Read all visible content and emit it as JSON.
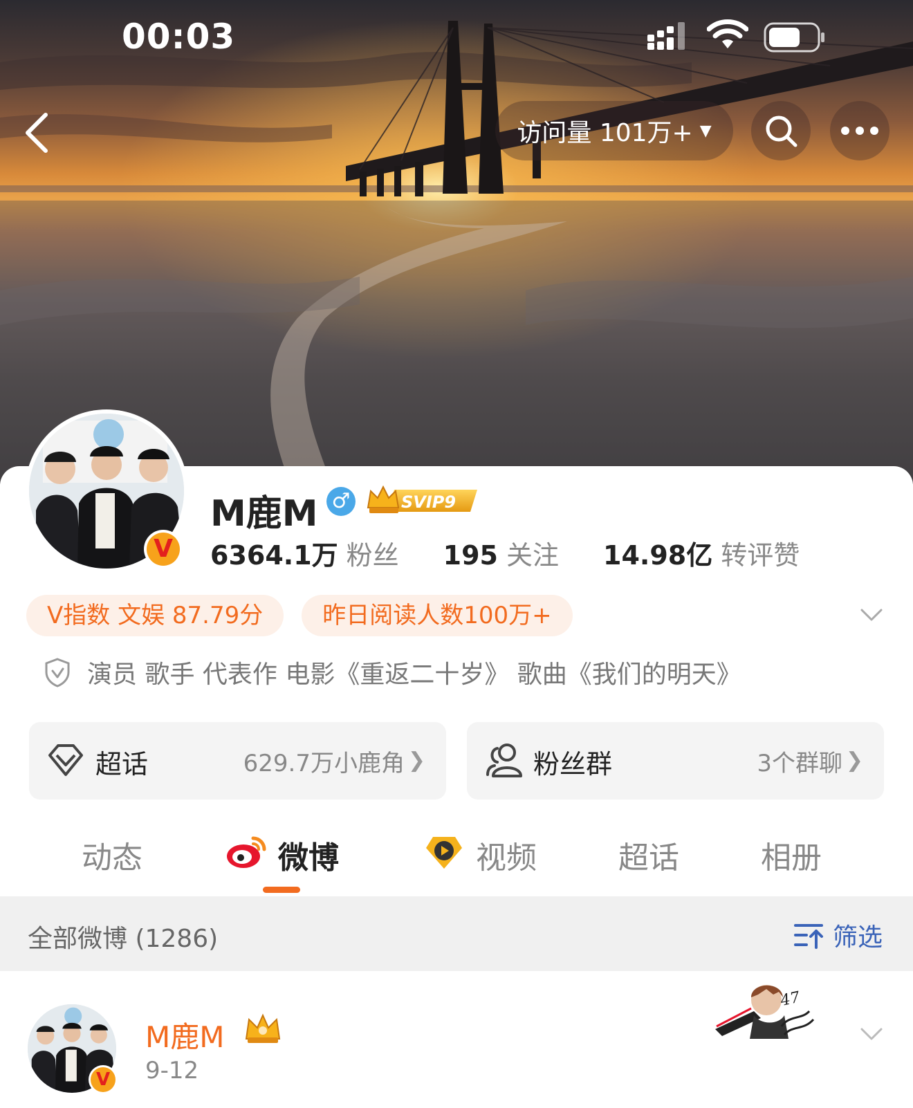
{
  "status_bar": {
    "time": "00:03"
  },
  "nav": {
    "visits_label": "访问量 101万+",
    "visits_caret": "▼"
  },
  "profile": {
    "name": "M鹿M",
    "gender_symbol": "♂",
    "svip_label": "SVIP9",
    "verified_mark": "V",
    "stats": [
      {
        "value": "6364.1万",
        "label": "粉丝"
      },
      {
        "value": "195",
        "label": "关注"
      },
      {
        "value": "14.98亿",
        "label": "转评赞"
      }
    ],
    "tags": [
      "V指数 文娱 87.79分",
      "昨日阅读人数100万+"
    ],
    "verification": "演员 歌手 代表作 电影《重返二十岁》 歌曲《我们的明天》"
  },
  "boxes": [
    {
      "title": "超话",
      "value": "629.7万小鹿角",
      "icon": "diamond-icon"
    },
    {
      "title": "粉丝群",
      "value": "3个群聊",
      "icon": "group-icon"
    }
  ],
  "tabs": [
    "动态",
    "微博",
    "视频",
    "超话",
    "相册"
  ],
  "active_tab": "微博",
  "filter": {
    "all_label": "全部微博 (1286)",
    "filter_label": "筛选"
  },
  "post": {
    "name": "M鹿M",
    "date": "9-12",
    "verified_mark": "V"
  },
  "colors": {
    "accent": "#f26b1f",
    "link": "#3a63b8",
    "gender": "#4aa8e8"
  }
}
